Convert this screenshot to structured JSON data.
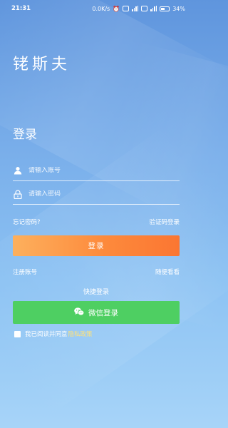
{
  "status_bar": {
    "time": "21:31",
    "network_speed": "0.0K/s",
    "battery": "34"
  },
  "brand": {
    "name": "铑斯夫"
  },
  "login": {
    "heading": "登录",
    "account_placeholder": "请输入账号",
    "password_placeholder": "请输入密码",
    "forgot_password": "忘记密码?",
    "code_login": "验证码登录",
    "login_button": "登录",
    "register": "注册账号",
    "browse": "随便看看",
    "quick_login": "快捷登录",
    "wechat_login": "微信登录",
    "agree_text": "我已阅读并同意",
    "privacy_policy": "隐私政策"
  },
  "colors": {
    "login_button": "#fd8a3c",
    "wechat_button": "#4ecf62",
    "privacy_link": "#ffe27a"
  }
}
